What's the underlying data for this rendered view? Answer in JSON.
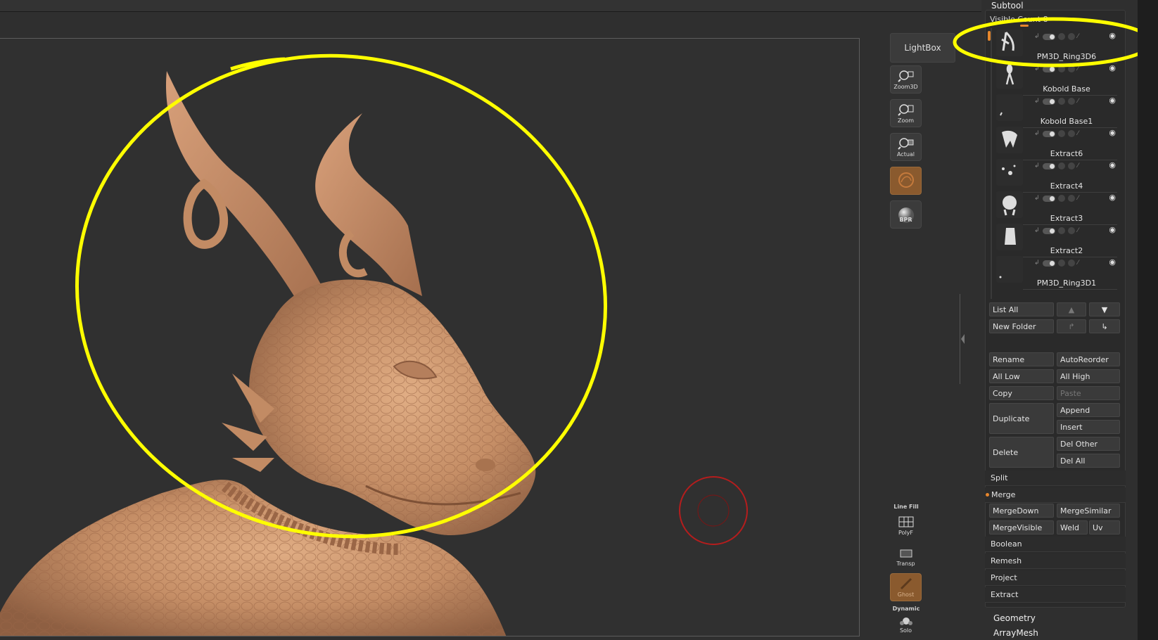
{
  "panel": {
    "title": "Subtool",
    "visible_count": "Visible Count 8"
  },
  "left_toolbar": {
    "lightbox": "LightBox",
    "zoom3d": "Zoom3D",
    "zoom": "Zoom",
    "actual": "Actual",
    "bpr": "BPR",
    "linefill_top": "Line Fill",
    "linefill": "PolyF",
    "transp": "Transp",
    "ghost": "Ghost",
    "dynamic": "Dynamic",
    "solo": "Solo"
  },
  "subtools": [
    {
      "name": "PM3D_Ring3D6",
      "selected": true
    },
    {
      "name": "Kobold Base"
    },
    {
      "name": "Kobold Base1"
    },
    {
      "name": "Extract6"
    },
    {
      "name": "Extract4"
    },
    {
      "name": "Extract3"
    },
    {
      "name": "Extract2"
    },
    {
      "name": "PM3D_Ring3D1"
    }
  ],
  "buttons": {
    "list_all": "List All",
    "new_folder": "New Folder",
    "rename": "Rename",
    "auto_reorder": "AutoReorder",
    "all_low": "All Low",
    "all_high": "All High",
    "copy": "Copy",
    "paste": "Paste",
    "duplicate": "Duplicate",
    "append": "Append",
    "insert": "Insert",
    "delete": "Delete",
    "del_other": "Del Other",
    "del_all": "Del All",
    "merge_down": "MergeDown",
    "merge_similar": "MergeSimilar",
    "merge_visible": "MergeVisible",
    "weld": "Weld",
    "uv": "Uv"
  },
  "sections": {
    "split": "Split",
    "merge": "Merge",
    "boolean": "Boolean",
    "remesh": "Remesh",
    "project": "Project",
    "extract": "Extract"
  },
  "below_panel": {
    "geometry": "Geometry",
    "arraymesh": "ArrayMesh"
  },
  "colors": {
    "accent": "#e6862c",
    "highlight": "#ffff00",
    "model": "#c9916a",
    "cursor": "#b51d1d"
  }
}
